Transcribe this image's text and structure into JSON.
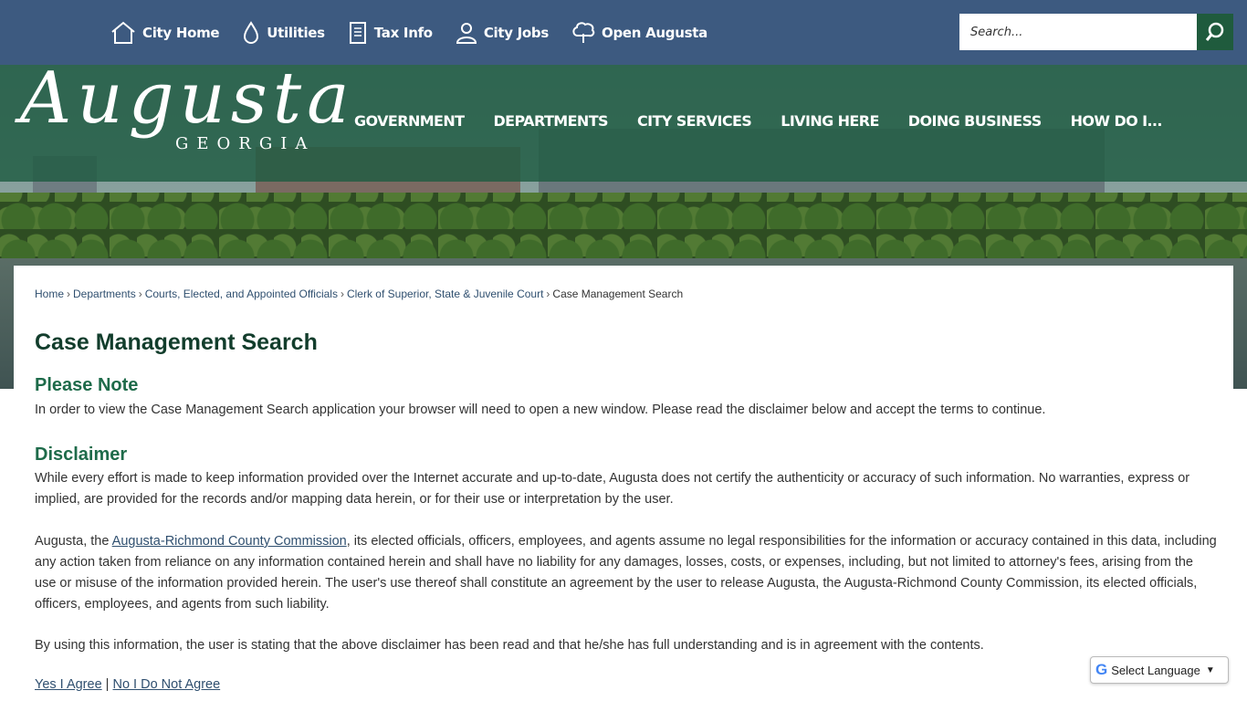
{
  "util_nav": {
    "items": [
      {
        "label": "City Home",
        "icon": "home-icon"
      },
      {
        "label": "Utilities",
        "icon": "water-drop-icon"
      },
      {
        "label": "Tax Info",
        "icon": "document-icon"
      },
      {
        "label": "City Jobs",
        "icon": "person-icon"
      },
      {
        "label": "Open Augusta",
        "icon": "tree-icon"
      }
    ]
  },
  "search": {
    "placeholder": "Search..."
  },
  "logo": {
    "script": "Augusta",
    "subtitle": "GEORGIA"
  },
  "main_nav": {
    "items": [
      {
        "label": "GOVERNMENT"
      },
      {
        "label": "DEPARTMENTS"
      },
      {
        "label": "CITY SERVICES"
      },
      {
        "label": "LIVING HERE"
      },
      {
        "label": "DOING BUSINESS"
      },
      {
        "label": "HOW DO I..."
      }
    ]
  },
  "breadcrumb": {
    "items": [
      "Home",
      "Departments",
      "Courts, Elected, and Appointed Officials",
      "Clerk of Superior, State & Juvenile Court"
    ],
    "current": "Case Management Search",
    "separator": "›"
  },
  "page": {
    "title": "Case Management Search",
    "note_heading": "Please Note",
    "note_text": "In order to view the Case Management Search application your browser will need to open a new window. Please read the disclaimer below and accept the terms to continue.",
    "disclaimer_heading": "Disclaimer",
    "disclaimer_p1": "While every effort is made to keep information provided over the Internet accurate and up-to-date, Augusta does not certify the authenticity or accuracy of such information. No warranties, express or implied, are provided for the records and/or mapping data herein, or for their use or interpretation by the user.",
    "disclaimer_p2_pre": "Augusta, the ",
    "disclaimer_p2_link": "Augusta-Richmond County Commission",
    "disclaimer_p2_post": ", its elected officials, officers, employees, and agents assume no legal responsibilities for the information or accuracy contained in this data, including any action taken from reliance on any information contained herein and shall have no liability for any damages, losses, costs, or expenses, including, but not limited to attorney's fees, arising from the use or misuse of the information provided herein. The user's use thereof shall constitute an agreement by the user to release Augusta, the Augusta-Richmond County Commission, its elected officials, officers, employees, and agents from such liability.",
    "disclaimer_p3": "By using this information, the user is stating that the above disclaimer has been read and that he/she has full understanding and is in agreement with the contents.",
    "agree_label": "Yes I Agree",
    "agree_sep": "|",
    "disagree_label": "No I Do Not Agree"
  },
  "translate": {
    "label": "Select Language",
    "g": "G",
    "arrow": "▼"
  },
  "colors": {
    "topbar": "#3d5a80",
    "nav_overlay": "#1e5c42",
    "heading": "#1e6b4a",
    "title": "#123d2c",
    "link": "#2f4f6f"
  }
}
